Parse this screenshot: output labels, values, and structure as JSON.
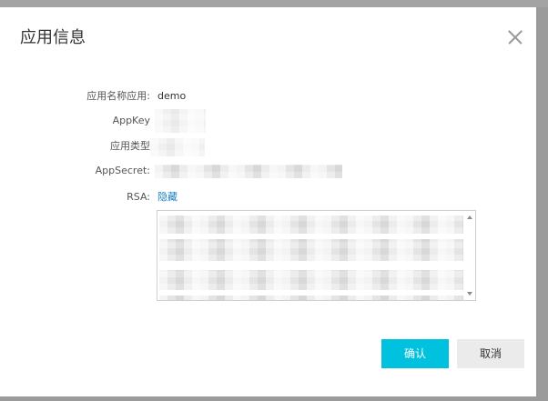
{
  "dialog": {
    "title": "应用信息"
  },
  "fields": {
    "app_name": {
      "label": "应用名称应用:",
      "value": "demo"
    },
    "app_key": {
      "label": "AppKey"
    },
    "app_type": {
      "label": "应用类型"
    },
    "app_secret": {
      "label": "AppSecret:"
    },
    "rsa": {
      "label": "RSA:",
      "toggle_link": "隐藏"
    }
  },
  "buttons": {
    "confirm": "确认",
    "cancel": "取消"
  },
  "icons": {
    "close": "close-icon",
    "scroll_up": "scroll-up-arrow-icon",
    "scroll_down": "scroll-down-arrow-icon"
  },
  "colors": {
    "primary": "#00c1de",
    "link": "#1a7fc4",
    "cancel_bg": "#ebebeb"
  }
}
